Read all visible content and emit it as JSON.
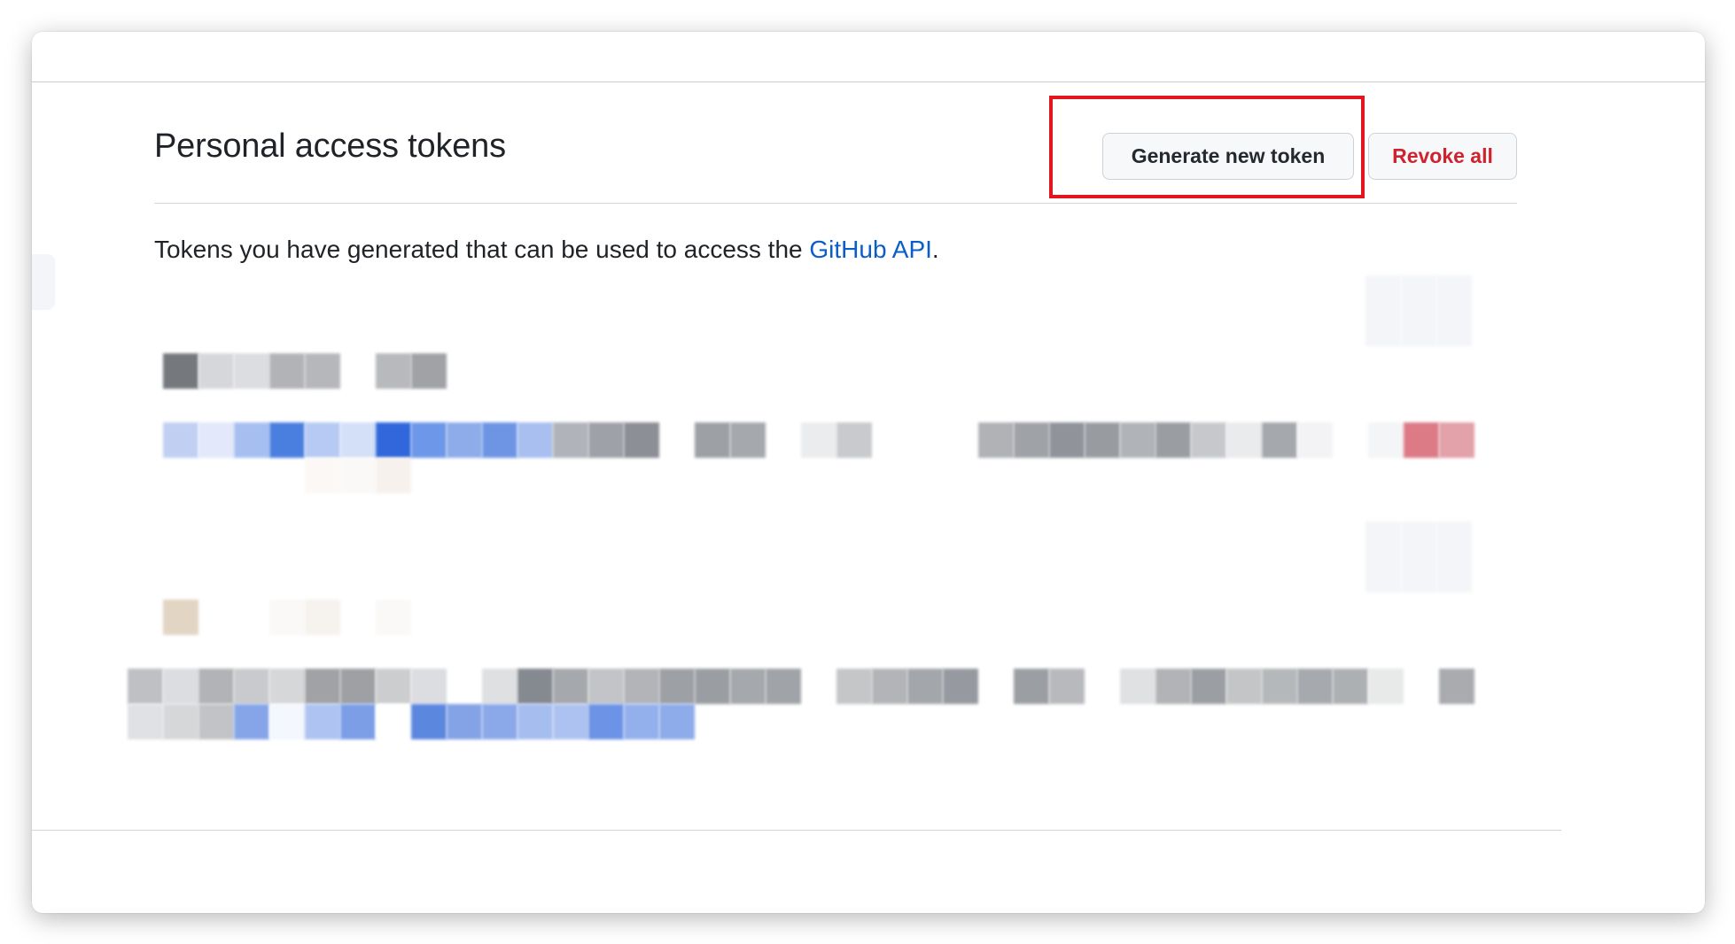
{
  "section": {
    "title": "Personal access tokens",
    "generate_button": "Generate new token",
    "revoke_button": "Revoke all"
  },
  "description": {
    "before": "Tokens you have generated that can be used to access the ",
    "link": "GitHub API",
    "after": "."
  },
  "colors": {
    "highlight_box": "#e3151f",
    "link": "#0b5ec7",
    "danger": "#cf222e"
  }
}
